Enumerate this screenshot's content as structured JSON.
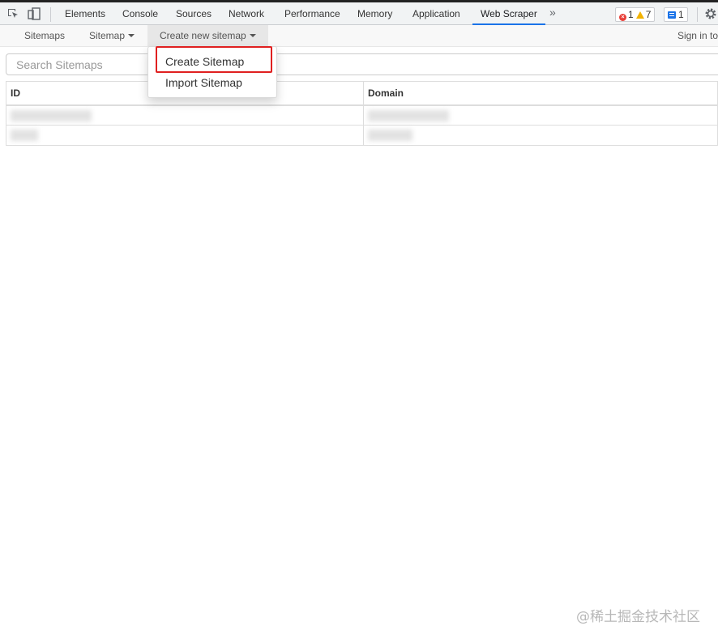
{
  "devtools": {
    "tabs": [
      {
        "label": "Elements"
      },
      {
        "label": "Console"
      },
      {
        "label": "Sources"
      },
      {
        "label": "Network"
      },
      {
        "label": "Performance"
      },
      {
        "label": "Memory"
      },
      {
        "label": "Application"
      },
      {
        "label": "Web Scraper",
        "active": true
      }
    ],
    "more_label": "»",
    "errors_count": "1",
    "warnings_count": "7",
    "messages_count": "1",
    "accent_color": "#1a73e8"
  },
  "nav": {
    "sitemaps_label": "Sitemaps",
    "sitemap_label": "Sitemap",
    "create_label": "Create new sitemap",
    "sign_in_label": "Sign in to"
  },
  "search": {
    "placeholder": "Search Sitemaps",
    "value": ""
  },
  "table": {
    "headers": {
      "id": "ID",
      "domain": "Domain"
    }
  },
  "dropdown": {
    "items": [
      {
        "label": "Create Sitemap",
        "highlighted": true
      },
      {
        "label": "Import Sitemap"
      }
    ],
    "highlight_color": "#e02020"
  },
  "watermark": "@稀土掘金技术社区"
}
